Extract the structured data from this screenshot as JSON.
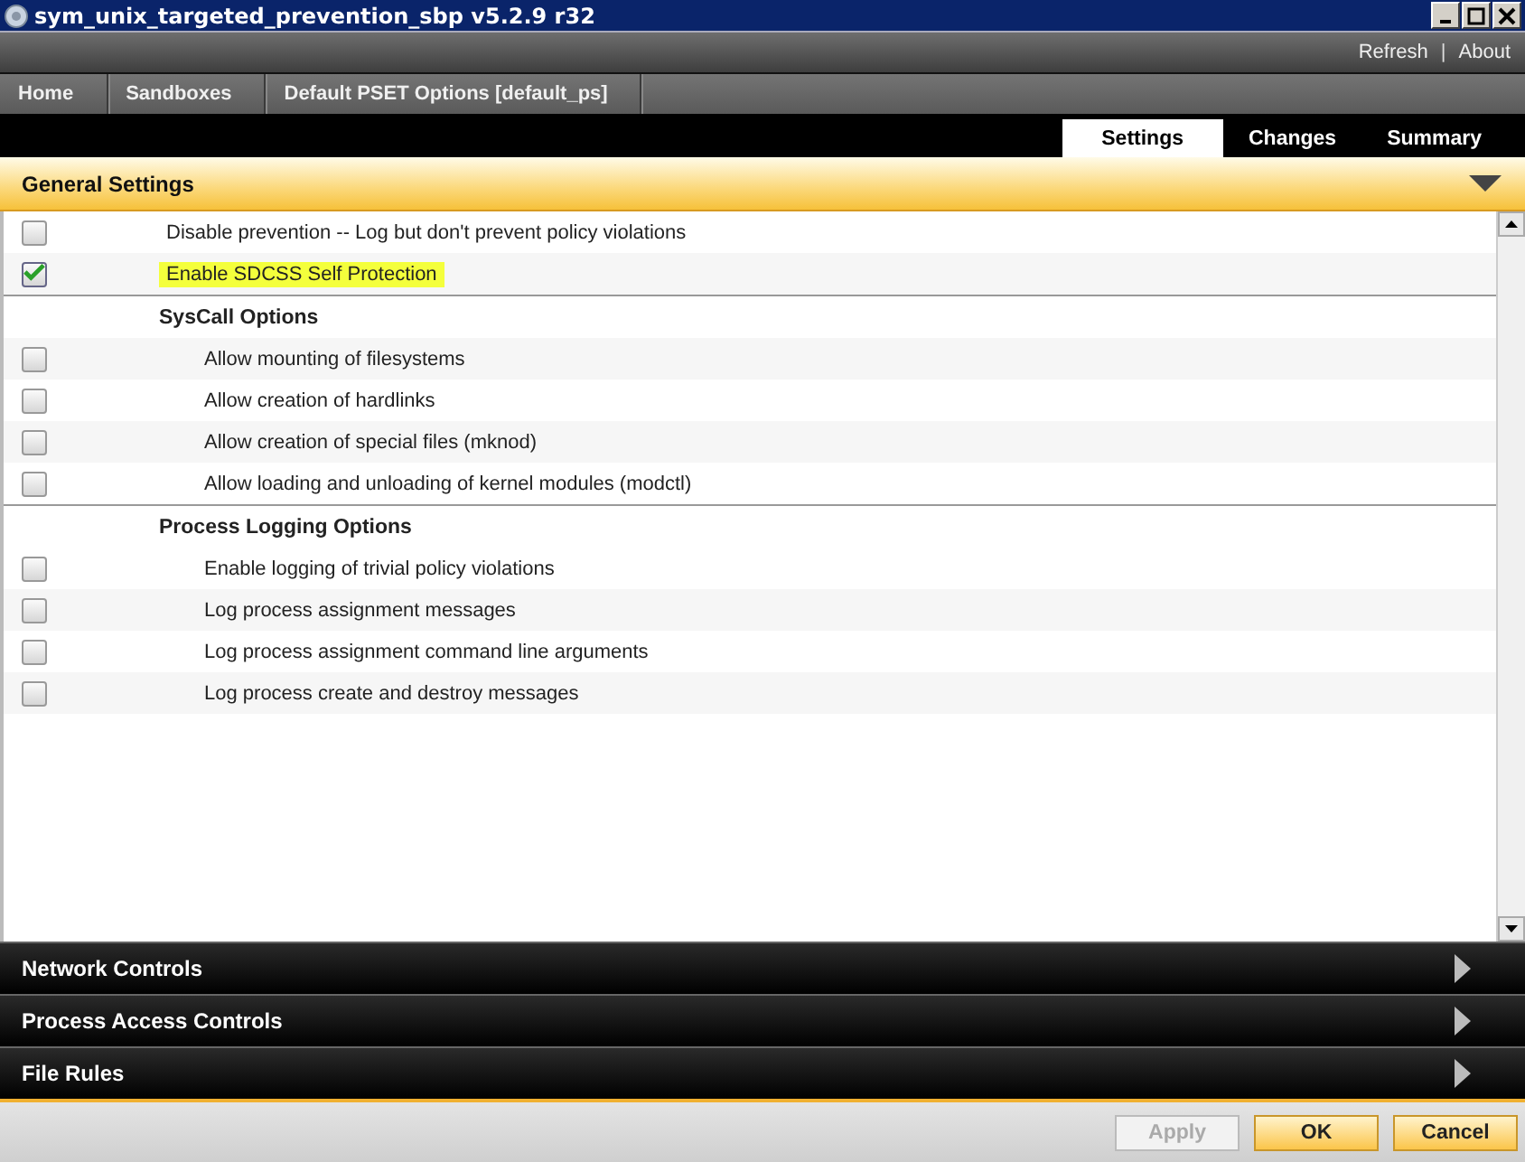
{
  "window": {
    "title": "sym_unix_targeted_prevention_sbp v5.2.9 r32"
  },
  "top_links": [
    "Refresh",
    "About"
  ],
  "top_links_separator": "|",
  "breadcrumb": [
    "Home",
    "Sandboxes",
    "Default PSET Options [default_ps]"
  ],
  "tabs": [
    {
      "label": "Settings",
      "selected": true
    },
    {
      "label": "Changes",
      "selected": false
    },
    {
      "label": "Summary",
      "selected": false
    }
  ],
  "general_settings": {
    "title": "General Settings",
    "expanded": true,
    "items": [
      {
        "kind": "option",
        "label": "Disable prevention -- Log but don't prevent policy violations",
        "checked": false,
        "highlighted": false
      },
      {
        "kind": "option",
        "label": "Enable SDCSS Self Protection",
        "checked": true,
        "highlighted": true
      },
      {
        "kind": "group",
        "label": "SysCall Options",
        "children": [
          {
            "label": "Allow mounting of filesystems",
            "checked": false
          },
          {
            "label": "Allow creation of hardlinks",
            "checked": false
          },
          {
            "label": "Allow creation of special files (mknod)",
            "checked": false
          },
          {
            "label": "Allow loading and unloading of kernel modules (modctl)",
            "checked": false
          }
        ]
      },
      {
        "kind": "group",
        "label": "Process Logging Options",
        "children": [
          {
            "label": "Enable logging of trivial policy violations",
            "checked": false
          },
          {
            "label": "Log process assignment messages",
            "checked": false
          },
          {
            "label": "Log process assignment command line arguments",
            "checked": false
          },
          {
            "label": "Log process create and destroy messages",
            "checked": false
          }
        ]
      }
    ]
  },
  "sections": [
    {
      "title": "Network Controls",
      "expanded": false
    },
    {
      "title": "Process Access Controls",
      "expanded": false
    },
    {
      "title": "File Rules",
      "expanded": false
    }
  ],
  "buttons": [
    {
      "label": "Apply",
      "disabled": true
    },
    {
      "label": "OK",
      "disabled": false
    },
    {
      "label": "Cancel",
      "disabled": false
    }
  ]
}
